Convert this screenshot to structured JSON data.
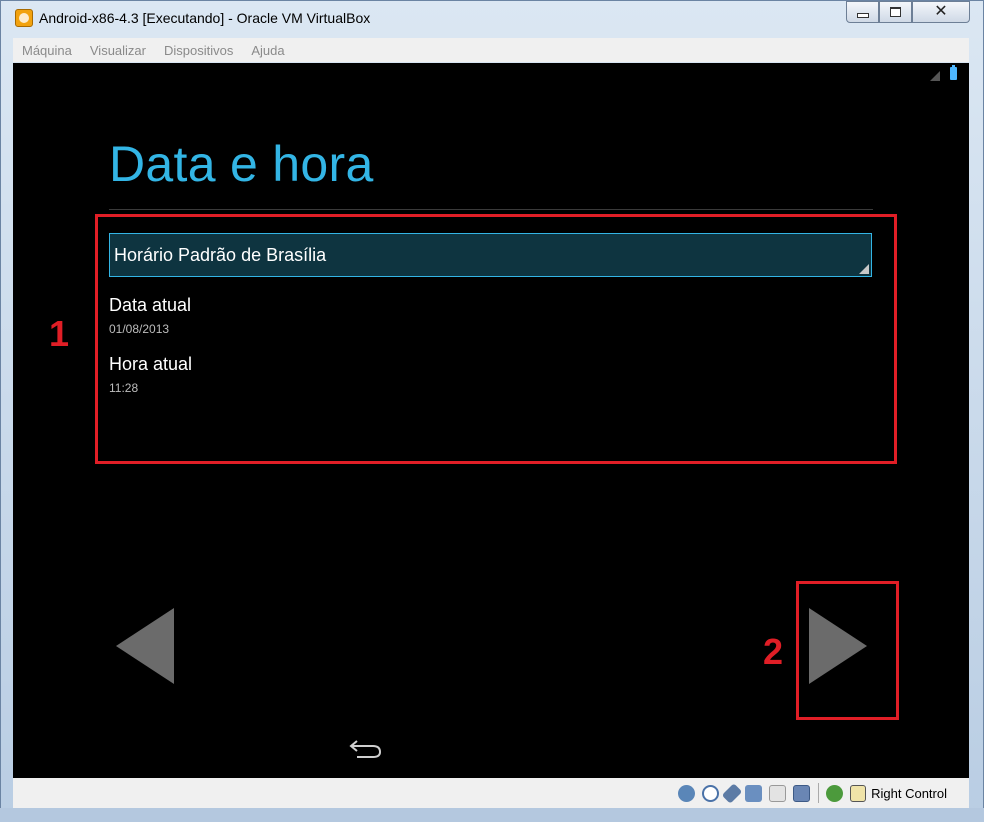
{
  "window": {
    "title": "Android-x86-4.3 [Executando] - Oracle VM VirtualBox",
    "icon": "virtualbox-icon",
    "controls": [
      "minimize-icon",
      "maximize-icon",
      "close-icon"
    ],
    "close_glyph": "✕"
  },
  "menubar": {
    "items": [
      "Máquina",
      "Visualizar",
      "Dispositivos",
      "Ajuda"
    ]
  },
  "android": {
    "heading": "Data e hora",
    "timezone": "Horário Padrão de Brasília",
    "date_label": "Data atual",
    "date_value": "01/08/2013",
    "time_label": "Hora atual",
    "time_value": "11:28",
    "accent_color": "#33b5e5",
    "nav_prev_icon": "arrow-left-icon",
    "nav_next_icon": "arrow-right-icon",
    "back_icon": "back-icon"
  },
  "annotations": {
    "box1_label": "1",
    "box2_label": "2",
    "color": "#e01e26"
  },
  "statusbar": {
    "icons": [
      "hard-disk-icon",
      "optical-drive-icon",
      "usb-icon",
      "network-icon",
      "shared-folder-icon",
      "display-icon",
      "mouse-integration-icon",
      "keyboard-capture-icon"
    ],
    "host_key": "Right Control"
  }
}
